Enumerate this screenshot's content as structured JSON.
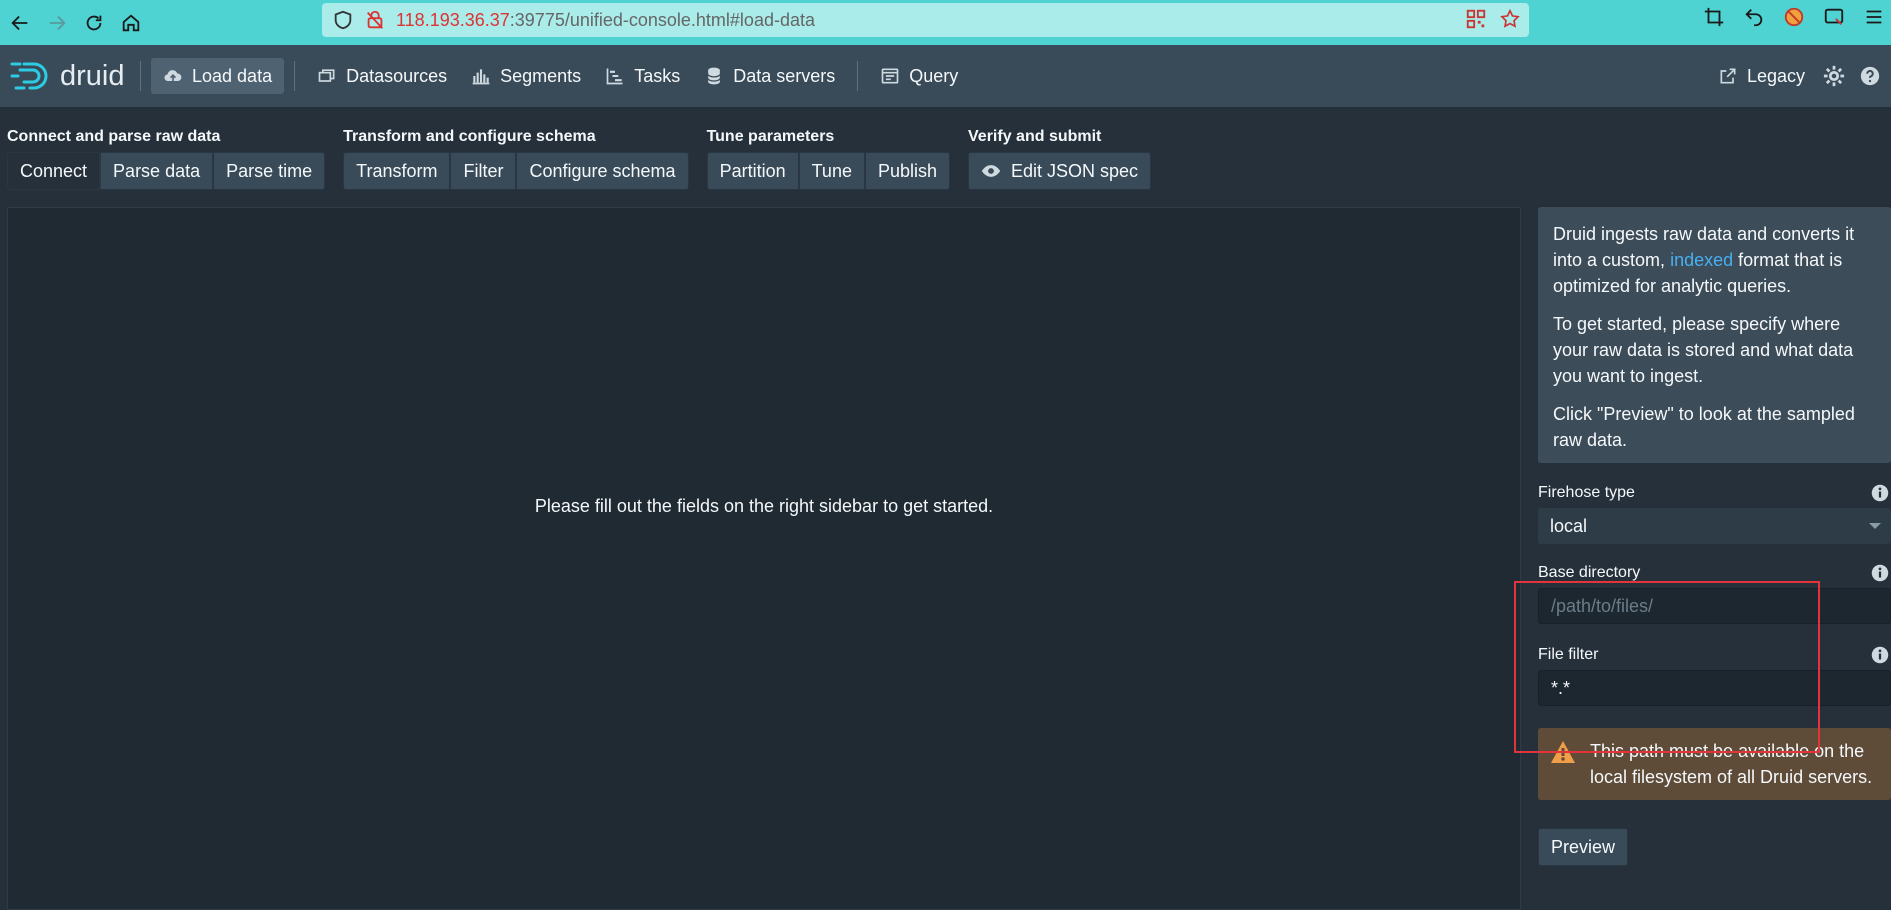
{
  "browser": {
    "url_host": "118.193.36.37",
    "url_rest": ":39775/unified-console.html#load-data"
  },
  "header": {
    "logo_text": "druid",
    "nav": [
      {
        "label": "Load data"
      },
      {
        "label": "Datasources"
      },
      {
        "label": "Segments"
      },
      {
        "label": "Tasks"
      },
      {
        "label": "Data servers"
      },
      {
        "label": "Query"
      }
    ],
    "legacy_label": "Legacy"
  },
  "steps": {
    "groups": [
      {
        "title": "Connect and parse raw data",
        "items": [
          "Connect",
          "Parse data",
          "Parse time"
        ]
      },
      {
        "title": "Transform and configure schema",
        "items": [
          "Transform",
          "Filter",
          "Configure schema"
        ]
      },
      {
        "title": "Tune parameters",
        "items": [
          "Partition",
          "Tune",
          "Publish"
        ]
      },
      {
        "title": "Verify and submit",
        "items": [
          "Edit JSON spec"
        ]
      }
    ]
  },
  "main": {
    "message": "Please fill out the fields on the right sidebar to get started."
  },
  "sidebar": {
    "callout_p1_a": "Druid ingests raw data and converts it into a custom,",
    "callout_p1_link": "indexed",
    "callout_p1_b": "format that is optimized for analytic queries.",
    "callout_p2": "To get started, please specify where your raw data is stored and what data you want to ingest.",
    "callout_p3": "Click \"Preview\" to look at the sampled raw data.",
    "firehose_label": "Firehose type",
    "firehose_value": "local",
    "base_dir_label": "Base directory",
    "base_dir_placeholder": "/path/to/files/",
    "file_filter_label": "File filter",
    "file_filter_value": "*.*",
    "warning": "This path must be available on the local filesystem of all Druid servers.",
    "preview_label": "Preview"
  },
  "colors": {
    "accent_link": "#48aff0",
    "highlight_box": "#e2343a",
    "warning_bg": "#5e4c38",
    "warning_icon": "#f29d49"
  }
}
